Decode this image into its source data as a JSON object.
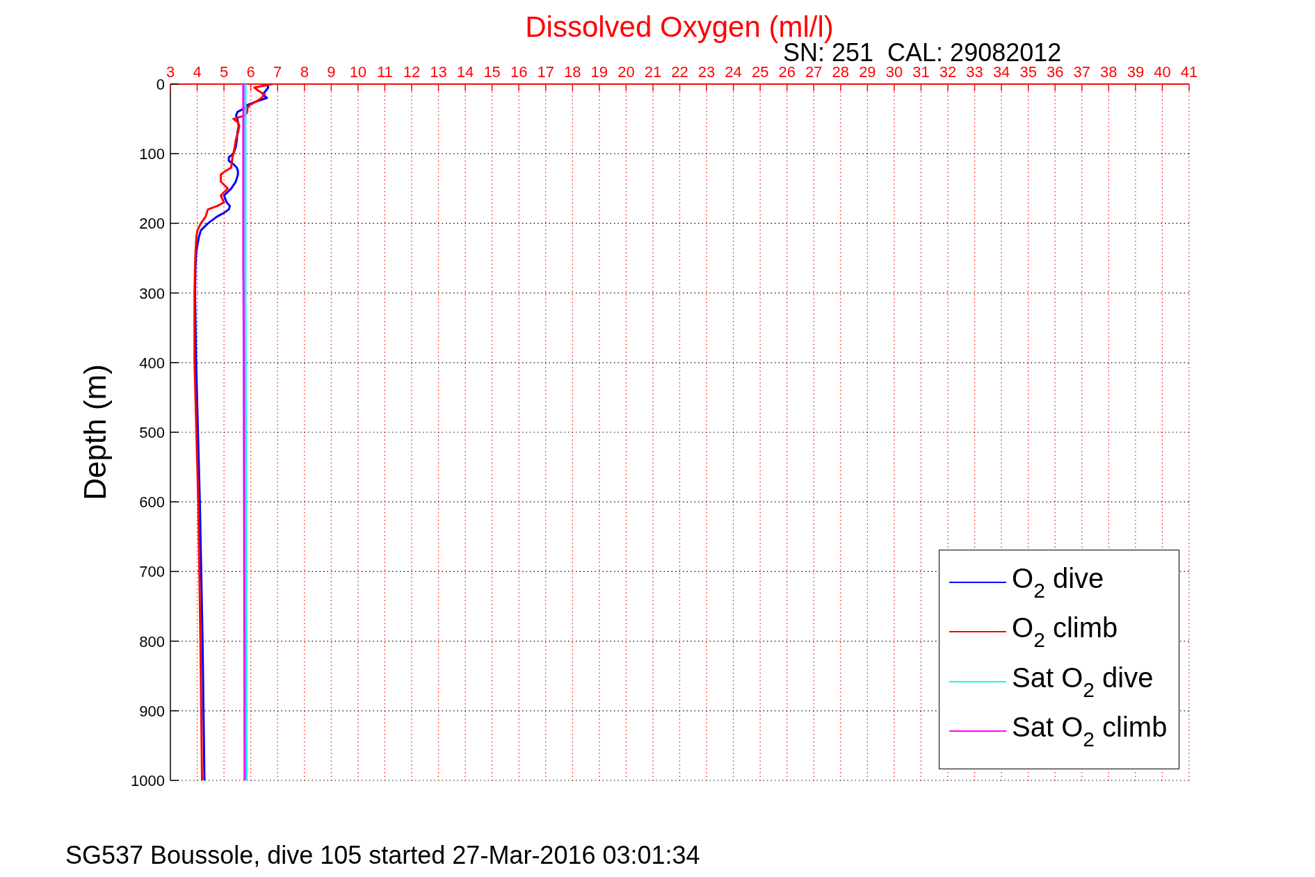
{
  "figure": {
    "calibration_label": "SN: 251  CAL: 29082012",
    "caption": "SG537 Boussole, dive 105 started 27-Mar-2016 03:01:34",
    "chart_data": {
      "type": "line",
      "title": "Dissolved Oxygen (ml/l)",
      "ylabel": "Depth (m)",
      "orientation": "horizontal",
      "x": [
        0,
        5,
        10,
        15,
        20,
        25,
        30,
        35,
        40,
        45,
        50,
        55,
        60,
        70,
        80,
        90,
        100,
        105,
        110,
        115,
        120,
        125,
        130,
        140,
        150,
        160,
        170,
        175,
        180,
        185,
        190,
        200,
        210,
        220,
        240,
        260,
        300,
        400,
        600,
        800,
        1000
      ],
      "grid": true,
      "legend": true,
      "xlim": [
        3,
        41
      ],
      "ylim": [
        1000,
        0
      ],
      "xticks": [
        3,
        4,
        5,
        6,
        7,
        8,
        9,
        10,
        11,
        12,
        13,
        14,
        15,
        16,
        17,
        18,
        19,
        20,
        21,
        22,
        23,
        24,
        25,
        26,
        27,
        28,
        29,
        30,
        31,
        32,
        33,
        34,
        35,
        36,
        37,
        38,
        39,
        40,
        41
      ],
      "yticks": [
        0,
        100,
        200,
        300,
        400,
        500,
        600,
        700,
        800,
        900,
        1000
      ],
      "series": [
        {
          "name": "O$_{2}$ dive",
          "color": "#0000ff",
          "values": [
            6.6,
            6.65,
            6.55,
            6.45,
            6.6,
            6.2,
            5.87,
            5.75,
            5.5,
            5.45,
            5.5,
            5.52,
            5.55,
            5.5,
            5.48,
            5.44,
            5.35,
            5.18,
            5.18,
            5.35,
            5.48,
            5.52,
            5.52,
            5.44,
            5.27,
            5.0,
            5.1,
            5.22,
            5.18,
            5.0,
            4.75,
            4.4,
            4.14,
            4.06,
            3.97,
            3.94,
            3.92,
            3.96,
            4.1,
            4.2,
            4.27
          ]
        },
        {
          "name": "O$_{2}$ climb",
          "color": "#ff0000",
          "values": [
            6.8,
            6.13,
            6.3,
            6.52,
            6.4,
            6.2,
            5.96,
            5.87,
            5.87,
            5.79,
            5.35,
            5.52,
            5.57,
            5.52,
            5.44,
            5.4,
            5.35,
            5.32,
            5.3,
            5.28,
            5.27,
            5.05,
            4.88,
            4.88,
            5.14,
            4.88,
            5.0,
            4.75,
            4.4,
            4.36,
            4.32,
            4.14,
            4.01,
            3.97,
            3.94,
            3.92,
            3.9,
            3.9,
            4.04,
            4.12,
            4.18
          ]
        },
        {
          "name": "Sat O$_{2}$ dive",
          "color": "#00ffff",
          "values": [
            5.8,
            5.8,
            5.8,
            5.8,
            5.8,
            5.8,
            5.8,
            5.8,
            5.8,
            5.8,
            5.8,
            5.8,
            5.8,
            5.8,
            5.8,
            5.8,
            5.8,
            5.8,
            5.8,
            5.8,
            5.8,
            5.8,
            5.8,
            5.8,
            5.8,
            5.8,
            5.8,
            5.8,
            5.8,
            5.8,
            5.8,
            5.8,
            5.8,
            5.8,
            5.8,
            5.8,
            5.8,
            5.81,
            5.82,
            5.83,
            5.84
          ]
        },
        {
          "name": "Sat O$_{2}$ climb",
          "color": "#ff00ff",
          "values": [
            5.72,
            5.72,
            5.72,
            5.72,
            5.72,
            5.72,
            5.72,
            5.72,
            5.72,
            5.72,
            5.72,
            5.72,
            5.72,
            5.72,
            5.72,
            5.72,
            5.72,
            5.72,
            5.72,
            5.72,
            5.72,
            5.72,
            5.72,
            5.72,
            5.72,
            5.72,
            5.72,
            5.72,
            5.72,
            5.72,
            5.72,
            5.72,
            5.72,
            5.72,
            5.72,
            5.72,
            5.73,
            5.74,
            5.75,
            5.76,
            5.77
          ]
        }
      ]
    }
  }
}
